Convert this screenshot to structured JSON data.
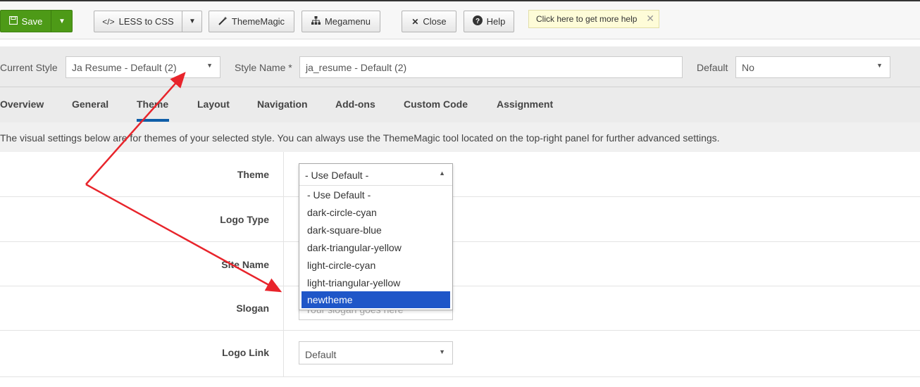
{
  "toolbar": {
    "save_label": "Save",
    "less_label": "LESS to CSS",
    "thememagic_label": "ThemeMagic",
    "megamenu_label": "Megamenu",
    "close_label": "Close",
    "help_label": "Help",
    "tooltip": "Click here to get more help"
  },
  "style": {
    "current_label": "Current Style",
    "current_value": "Ja Resume - Default (2)",
    "name_label": "Style Name *",
    "name_value": "ja_resume - Default (2)",
    "default_label": "Default",
    "default_value": "No"
  },
  "tabs": [
    "Overview",
    "General",
    "Theme",
    "Layout",
    "Navigation",
    "Add-ons",
    "Custom Code",
    "Assignment"
  ],
  "active_tab": "Theme",
  "description": "The visual settings below are for themes of your selected style. You can always use the ThemeMagic tool located on the top-right panel for further advanced settings.",
  "fields": {
    "theme_label": "Theme",
    "logotype_label": "Logo Type",
    "sitename_label": "Site Name",
    "slogan_label": "Slogan",
    "slogan_placeholder": "Your slogan goes here",
    "logolink_label": "Logo Link",
    "logolink_value": "Default"
  },
  "theme_dropdown": {
    "selected": "- Use Default -",
    "options": [
      "- Use Default -",
      "dark-circle-cyan",
      "dark-square-blue",
      "dark-triangular-yellow",
      "light-circle-cyan",
      "light-triangular-yellow",
      "newtheme"
    ],
    "highlighted": "newtheme"
  },
  "colors": {
    "save_green": "#4d9a17",
    "active_tab_bar": "#0f5ea8",
    "highlight": "#1f56c8",
    "annotation_arrow": "#e8242b"
  },
  "icons": {
    "save": "floppy-icon",
    "less": "code-icon",
    "thememagic": "magic-wand-icon",
    "megamenu": "sitemap-icon",
    "close": "x-icon",
    "help": "question-circle-icon"
  }
}
